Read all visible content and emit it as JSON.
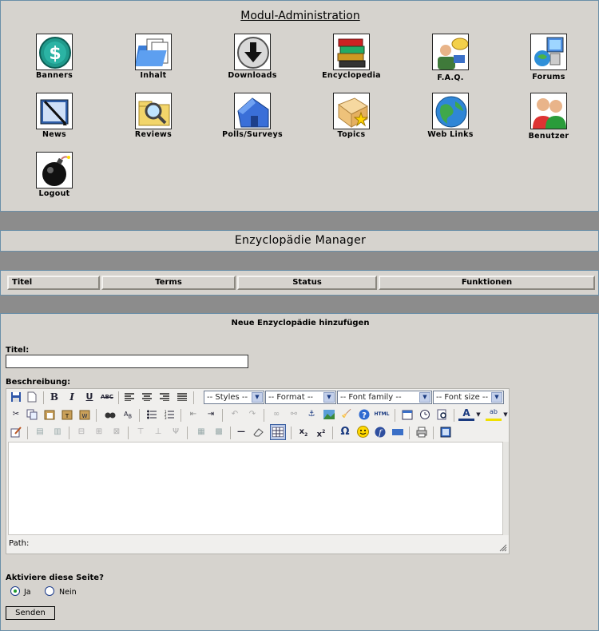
{
  "modules": {
    "title": "Modul-Administration",
    "items": [
      {
        "label": "Banners",
        "icon": "dollar-coin-icon"
      },
      {
        "label": "Inhalt",
        "icon": "folder-docs-icon"
      },
      {
        "label": "Downloads",
        "icon": "download-arrow-icon"
      },
      {
        "label": "Encyclopedia",
        "icon": "books-icon"
      },
      {
        "label": "F.A.Q.",
        "icon": "person-speech-icon"
      },
      {
        "label": "Forums",
        "icon": "computer-globe-icon"
      },
      {
        "label": "News",
        "icon": "newspaper-pen-icon"
      },
      {
        "label": "Reviews",
        "icon": "magnifier-folder-icon"
      },
      {
        "label": "Polls/Surveys",
        "icon": "house-icon"
      },
      {
        "label": "Topics",
        "icon": "star-box-icon"
      },
      {
        "label": "Web Links",
        "icon": "globe-icon"
      },
      {
        "label": "Benutzer",
        "icon": "users-icon"
      },
      {
        "label": "Logout",
        "icon": "bomb-icon"
      }
    ]
  },
  "manager": {
    "title": "Enzyclopädie Manager"
  },
  "table": {
    "headers": [
      "Titel",
      "Terms",
      "Status",
      "Funktionen"
    ]
  },
  "form": {
    "heading": "Neue Enzyclopädie hinzufügen",
    "title_label": "Titel:",
    "title_value": "",
    "desc_label": "Beschreibung:",
    "editor": {
      "selects": [
        "-- Styles --",
        "-- Format --",
        "-- Font family --",
        "-- Font size --"
      ],
      "path_label": "Path:"
    },
    "activate_label": "Aktiviere diese Seite?",
    "radio_yes": "Ja",
    "radio_no": "Nein",
    "submit_label": "Senden"
  }
}
